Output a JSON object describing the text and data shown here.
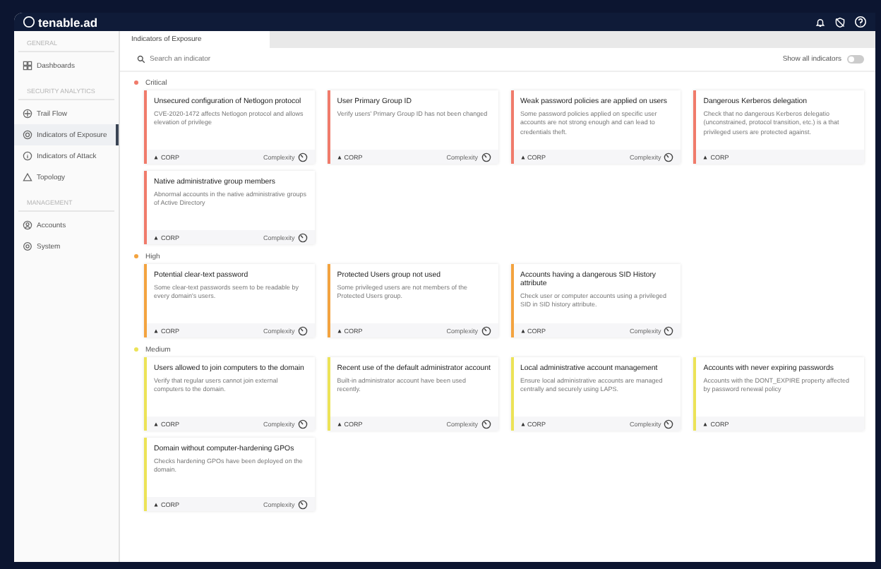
{
  "topbar": {
    "logo": "tenable.ad"
  },
  "sidebar": {
    "sections": [
      {
        "heading": "GENERAL",
        "items": [
          {
            "label": "Dashboards",
            "selected": false
          }
        ]
      },
      {
        "heading": "SECURITY ANALYTICS",
        "items": [
          {
            "label": "Trail Flow",
            "selected": false
          },
          {
            "label": "Indicators of Exposure",
            "selected": true
          },
          {
            "label": "Indicators of Attack",
            "selected": false
          },
          {
            "label": "Topology",
            "selected": false
          }
        ]
      },
      {
        "heading": "MANAGEMENT",
        "items": [
          {
            "label": "Accounts",
            "selected": false
          },
          {
            "label": "System",
            "selected": false
          }
        ]
      }
    ]
  },
  "tabs": [
    {
      "label": "Indicators of Exposure",
      "selected": true
    }
  ],
  "search": {
    "placeholder": "Search an indicator"
  },
  "show_all": {
    "label": "Show all indicators",
    "on": false
  },
  "groups": [
    {
      "name": "Critical",
      "color": "#f07b6b",
      "cards": [
        {
          "title": "Unsecured configuration of Netlogon protocol",
          "description": "CVE-2020-1472 affects Netlogon protocol and allows elevation of privilege",
          "domain": "CORP",
          "complexity": "Complexity"
        },
        {
          "title": "User Primary Group ID",
          "description": "Verify users' Primary Group ID has not been changed",
          "domain": "CORP",
          "complexity": "Complexity"
        },
        {
          "title": "Weak password policies are applied on users",
          "description": "Some password policies applied on specific user accounts are not strong enough and can lead to credentials theft.",
          "domain": "CORP",
          "complexity": "Complexity"
        },
        {
          "title": "Dangerous Kerberos delegation",
          "description": "Check that no dangerous Kerberos delegatio (unconstrained, protocol transition, etc.) is a that privileged users are protected against.",
          "domain": "CORP"
        },
        {
          "title": "Native administrative group members",
          "description": "Abnormal accounts in the native administrative groups of Active Directory",
          "domain": "CORP",
          "complexity": "Complexity"
        }
      ]
    },
    {
      "name": "High",
      "color": "#f3a33f",
      "cards": [
        {
          "title": "Potential clear-text password",
          "description": "Some clear-text passwords seem to be readable by every domain's users.",
          "domain": "CORP",
          "complexity": "Complexity"
        },
        {
          "title": "Protected Users group not used",
          "description": "Some privileged users are not members of the Protected Users group.",
          "domain": "CORP",
          "complexity": "Complexity"
        },
        {
          "title": "Accounts having a dangerous SID History attribute",
          "description": "Check user or computer accounts using a privileged SID in SID history attribute.",
          "domain": "CORP",
          "complexity": "Complexity"
        }
      ]
    },
    {
      "name": "Medium",
      "color": "#ece357",
      "cards": [
        {
          "title": "Users allowed to join computers to the domain",
          "description": "Verify that regular users cannot join external computers to the domain.",
          "domain": "CORP",
          "complexity": "Complexity"
        },
        {
          "title": "Recent use of the default administrator account",
          "description": "Built-in administrator account have been used recently.",
          "domain": "CORP",
          "complexity": "Complexity"
        },
        {
          "title": "Local administrative account management",
          "description": "Ensure local administrative accounts are managed centrally and securely using LAPS.",
          "domain": "CORP",
          "complexity": "Complexity"
        },
        {
          "title": "Accounts with never expiring passwords",
          "description": "Accounts with the DONT_EXPIRE property affected by password renewal policy",
          "domain": "CORP"
        },
        {
          "title": "Domain without computer-hardening GPOs",
          "description": "Checks hardening GPOs have been deployed on the domain.",
          "domain": "CORP",
          "complexity": "Complexity"
        }
      ]
    }
  ]
}
